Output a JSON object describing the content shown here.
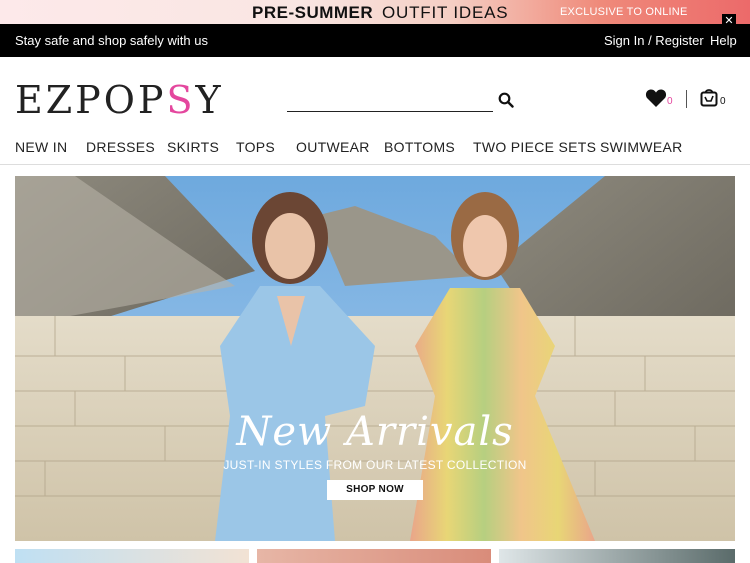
{
  "promo": {
    "pre_summer": "PRE-SUMMER",
    "outfit_ideas": "OUTFIT IDEAS",
    "exclusive": "EXCLUSIVE TO ONLINE"
  },
  "topbar": {
    "message": "Stay safe and shop safely with us",
    "close": "✕",
    "sign_in": "Sign In / Register",
    "help": "Help"
  },
  "header": {
    "logo_a": "EZPOP",
    "logo_b": "S",
    "logo_c": "Y",
    "search_placeholder": "",
    "wishlist_count": "0",
    "cart_count": "0",
    "brand_accent": "#e4479e"
  },
  "nav": {
    "items": [
      "NEW IN",
      "DRESSES",
      "SKIRTS",
      "TOPS",
      "OUTWEAR",
      "BOTTOMS",
      "TWO PIECE SETS",
      "SWIMWEAR"
    ]
  },
  "hero": {
    "title": "New Arrivals",
    "subtitle": "JUST-IN STYLES FROM OUR LATEST COLLECTION",
    "cta": "SHOP NOW"
  },
  "icons": {
    "search": "search-icon",
    "wishlist": "heart-icon",
    "cart": "bag-icon"
  }
}
